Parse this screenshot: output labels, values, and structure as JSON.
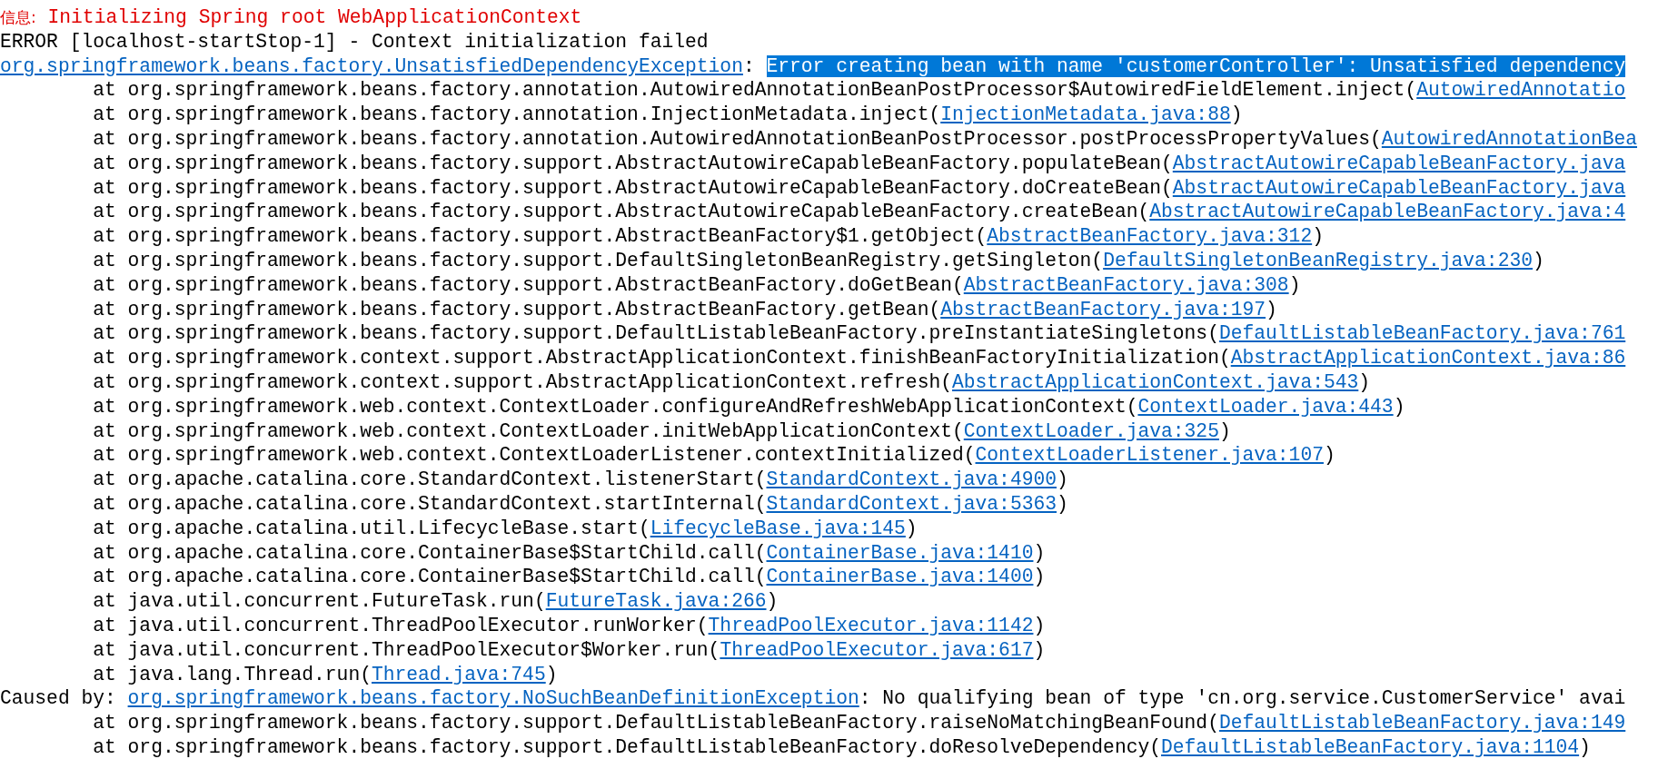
{
  "console": {
    "lines": [
      {
        "kind": "info",
        "label": "信息:",
        "text": " Initializing Spring root WebApplicationContext"
      },
      {
        "kind": "plain",
        "text": "ERROR [localhost-startStop-1] - Context initialization failed"
      },
      {
        "kind": "exception",
        "link": "org.springframework.beans.factory.UnsatisfiedDependencyException",
        "text": ": ",
        "highlight": "Error creating bean with name 'customerController': Unsatisfied dependency"
      },
      {
        "kind": "frame",
        "text": "at org.springframework.beans.factory.annotation.AutowiredAnnotationBeanPostProcessor$AutowiredFieldElement.inject(",
        "link": "AutowiredAnnotatio"
      },
      {
        "kind": "frame",
        "text": "at org.springframework.beans.factory.annotation.InjectionMetadata.inject(",
        "link": "InjectionMetadata.java:88",
        "suffix": ")"
      },
      {
        "kind": "frame",
        "text": "at org.springframework.beans.factory.annotation.AutowiredAnnotationBeanPostProcessor.postProcessPropertyValues(",
        "link": "AutowiredAnnotationBea"
      },
      {
        "kind": "frame",
        "text": "at org.springframework.beans.factory.support.AbstractAutowireCapableBeanFactory.populateBean(",
        "link": "AbstractAutowireCapableBeanFactory.java"
      },
      {
        "kind": "frame",
        "text": "at org.springframework.beans.factory.support.AbstractAutowireCapableBeanFactory.doCreateBean(",
        "link": "AbstractAutowireCapableBeanFactory.java"
      },
      {
        "kind": "frame",
        "text": "at org.springframework.beans.factory.support.AbstractAutowireCapableBeanFactory.createBean(",
        "link": "AbstractAutowireCapableBeanFactory.java:4"
      },
      {
        "kind": "frame",
        "text": "at org.springframework.beans.factory.support.AbstractBeanFactory$1.getObject(",
        "link": "AbstractBeanFactory.java:312",
        "suffix": ")"
      },
      {
        "kind": "frame",
        "text": "at org.springframework.beans.factory.support.DefaultSingletonBeanRegistry.getSingleton(",
        "link": "DefaultSingletonBeanRegistry.java:230",
        "suffix": ")"
      },
      {
        "kind": "frame",
        "text": "at org.springframework.beans.factory.support.AbstractBeanFactory.doGetBean(",
        "link": "AbstractBeanFactory.java:308",
        "suffix": ")"
      },
      {
        "kind": "frame",
        "text": "at org.springframework.beans.factory.support.AbstractBeanFactory.getBean(",
        "link": "AbstractBeanFactory.java:197",
        "suffix": ")"
      },
      {
        "kind": "frame",
        "text": "at org.springframework.beans.factory.support.DefaultListableBeanFactory.preInstantiateSingletons(",
        "link": "DefaultListableBeanFactory.java:761"
      },
      {
        "kind": "frame",
        "text": "at org.springframework.context.support.AbstractApplicationContext.finishBeanFactoryInitialization(",
        "link": "AbstractApplicationContext.java:86"
      },
      {
        "kind": "frame",
        "text": "at org.springframework.context.support.AbstractApplicationContext.refresh(",
        "link": "AbstractApplicationContext.java:543",
        "suffix": ")"
      },
      {
        "kind": "frame",
        "text": "at org.springframework.web.context.ContextLoader.configureAndRefreshWebApplicationContext(",
        "link": "ContextLoader.java:443",
        "suffix": ")"
      },
      {
        "kind": "frame",
        "text": "at org.springframework.web.context.ContextLoader.initWebApplicationContext(",
        "link": "ContextLoader.java:325",
        "suffix": ")"
      },
      {
        "kind": "frame",
        "text": "at org.springframework.web.context.ContextLoaderListener.contextInitialized(",
        "link": "ContextLoaderListener.java:107",
        "suffix": ")"
      },
      {
        "kind": "frame",
        "text": "at org.apache.catalina.core.StandardContext.listenerStart(",
        "link": "StandardContext.java:4900",
        "suffix": ")"
      },
      {
        "kind": "frame",
        "text": "at org.apache.catalina.core.StandardContext.startInternal(",
        "link": "StandardContext.java:5363",
        "suffix": ")"
      },
      {
        "kind": "frame",
        "text": "at org.apache.catalina.util.LifecycleBase.start(",
        "link": "LifecycleBase.java:145",
        "suffix": ")"
      },
      {
        "kind": "frame",
        "text": "at org.apache.catalina.core.ContainerBase$StartChild.call(",
        "link": "ContainerBase.java:1410",
        "suffix": ")"
      },
      {
        "kind": "frame",
        "text": "at org.apache.catalina.core.ContainerBase$StartChild.call(",
        "link": "ContainerBase.java:1400",
        "suffix": ")"
      },
      {
        "kind": "frame",
        "text": "at java.util.concurrent.FutureTask.run(",
        "link": "FutureTask.java:266",
        "suffix": ")"
      },
      {
        "kind": "frame",
        "text": "at java.util.concurrent.ThreadPoolExecutor.runWorker(",
        "link": "ThreadPoolExecutor.java:1142",
        "suffix": ")"
      },
      {
        "kind": "frame",
        "text": "at java.util.concurrent.ThreadPoolExecutor$Worker.run(",
        "link": "ThreadPoolExecutor.java:617",
        "suffix": ")"
      },
      {
        "kind": "frame",
        "text": "at java.lang.Thread.run(",
        "link": "Thread.java:745",
        "suffix": ")"
      },
      {
        "kind": "caused",
        "label": "Caused by: ",
        "link": "org.springframework.beans.factory.NoSuchBeanDefinitionException",
        "text": ": No qualifying bean of type 'cn.org.service.CustomerService' avai"
      },
      {
        "kind": "frame",
        "text": "at org.springframework.beans.factory.support.DefaultListableBeanFactory.raiseNoMatchingBeanFound(",
        "link": "DefaultListableBeanFactory.java:149"
      },
      {
        "kind": "frame",
        "text": "at org.springframework.beans.factory.support.DefaultListableBeanFactory.doResolveDependency(",
        "link": "DefaultListableBeanFactory.java:1104",
        "suffix": ")"
      }
    ]
  }
}
